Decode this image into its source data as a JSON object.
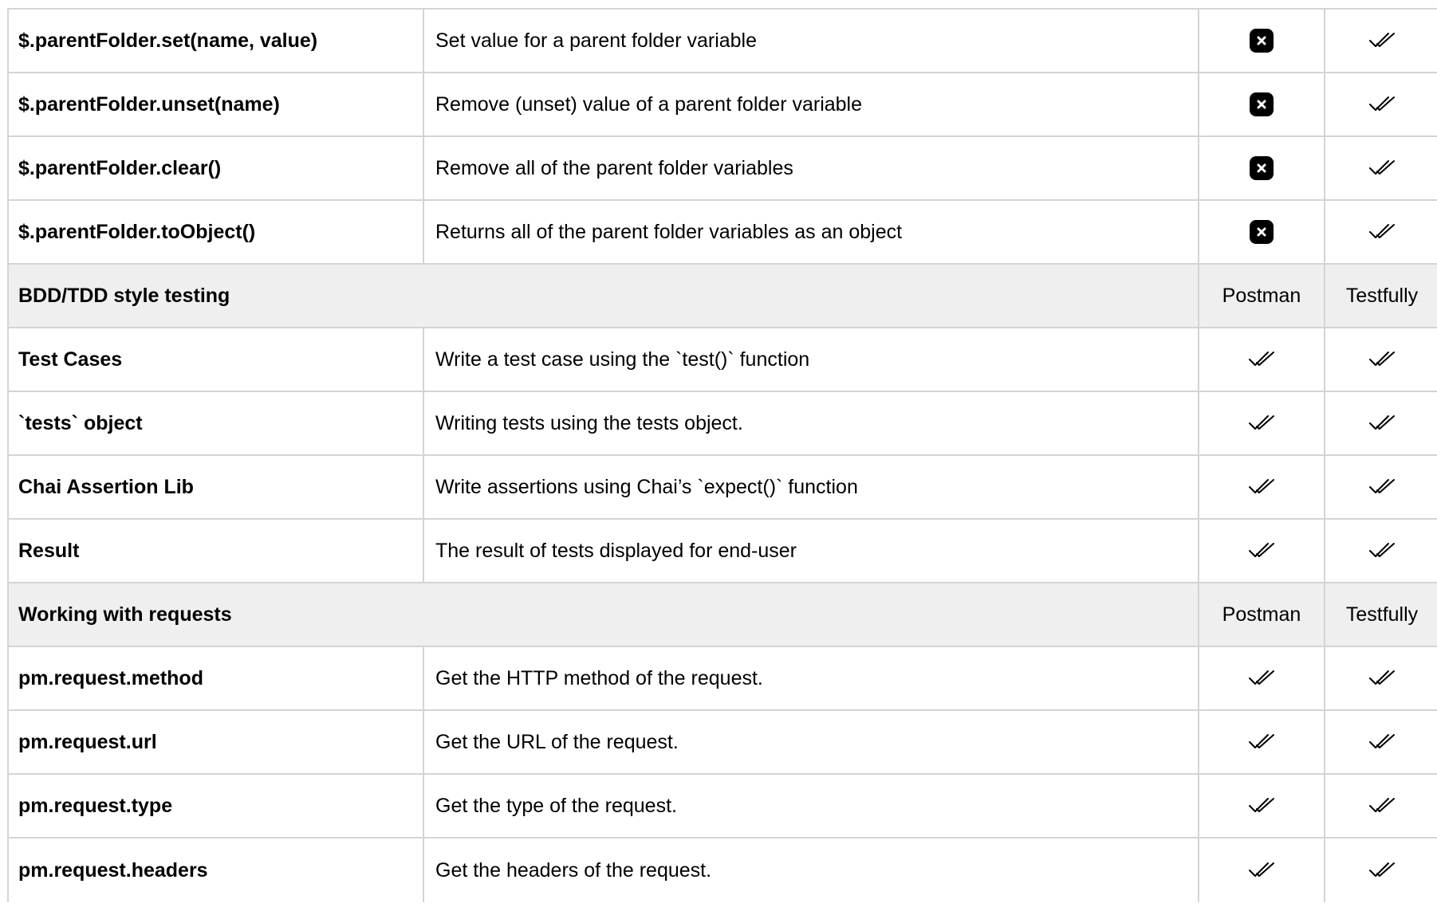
{
  "table": {
    "rows": [
      {
        "type": "item",
        "name": "$.parentFolder.set(name, value)",
        "description": "Set value for a parent folder variable",
        "postman": "cross-icon",
        "testfully": "double-check-icon"
      },
      {
        "type": "item",
        "name": "$.parentFolder.unset(name)",
        "description": "Remove (unset) value of a parent folder variable",
        "postman": "cross-icon",
        "testfully": "double-check-icon"
      },
      {
        "type": "item",
        "name": "$.parentFolder.clear()",
        "description": "Remove all of the parent folder variables",
        "postman": "cross-icon",
        "testfully": "double-check-icon"
      },
      {
        "type": "item",
        "name": "$.parentFolder.toObject()",
        "description": "Returns all of the parent folder variables as an object",
        "postman": "cross-icon",
        "testfully": "double-check-icon"
      },
      {
        "type": "section",
        "title": "BDD/TDD style testing",
        "postman": "Postman",
        "testfully": "Testfully"
      },
      {
        "type": "item",
        "name": "Test Cases",
        "description": "Write a test case using the `test()` function",
        "postman": "double-check-icon",
        "testfully": "double-check-icon"
      },
      {
        "type": "item",
        "name": "`tests` object",
        "description": "Writing tests using the tests object.",
        "postman": "double-check-icon",
        "testfully": "double-check-icon"
      },
      {
        "type": "item",
        "name": "Chai Assertion Lib",
        "description": "Write assertions using Chai’s `expect()` function",
        "postman": "double-check-icon",
        "testfully": "double-check-icon"
      },
      {
        "type": "item",
        "name": "Result",
        "description": "The result of tests displayed for end-user",
        "postman": "double-check-icon",
        "testfully": "double-check-icon"
      },
      {
        "type": "section",
        "title": "Working with requests",
        "postman": "Postman",
        "testfully": "Testfully"
      },
      {
        "type": "item",
        "name": "pm.request.method",
        "description": "Get the HTTP method of the request.",
        "postman": "double-check-icon",
        "testfully": "double-check-icon"
      },
      {
        "type": "item",
        "name": "pm.request.url",
        "description": "Get the URL of the request.",
        "postman": "double-check-icon",
        "testfully": "double-check-icon"
      },
      {
        "type": "item",
        "name": "pm.request.type",
        "description": "Get the type of the request.",
        "postman": "double-check-icon",
        "testfully": "double-check-icon"
      },
      {
        "type": "item",
        "name": "pm.request.headers",
        "description": "Get the headers of the request.",
        "postman": "double-check-icon",
        "testfully": "double-check-icon"
      }
    ]
  },
  "colors": {
    "border": "#d4d4d4",
    "section_bg": "#efefef",
    "cross_bg": "#000000",
    "check": "#000000"
  }
}
